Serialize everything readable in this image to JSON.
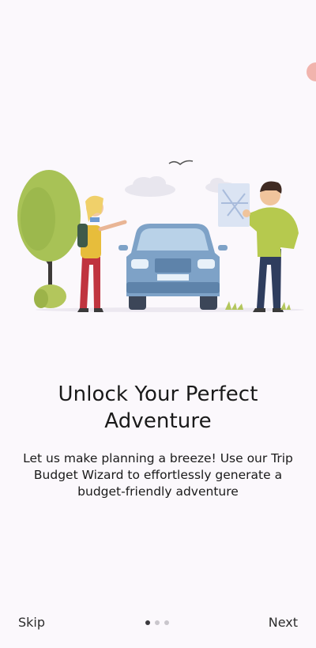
{
  "onboarding": {
    "title": "Unlock Your Perfect Adventure",
    "description": "Let us make planning a breeze! Use our Trip Budget Wizard to effortlessly generate a budget-friendly adventure",
    "illustration_icon": "road-trip-illustration",
    "page_indicator": {
      "current": 1,
      "total": 3
    }
  },
  "footer": {
    "skip_label": "Skip",
    "next_label": "Next"
  },
  "colors": {
    "background": "#fbf8fc",
    "accent_dot": "#f1b4ad",
    "car": "#7ea2c7",
    "tree": "#a8c256",
    "shirt_man": "#b6c94e",
    "pants_woman": "#c0343f",
    "text": "#1a1a1a"
  }
}
